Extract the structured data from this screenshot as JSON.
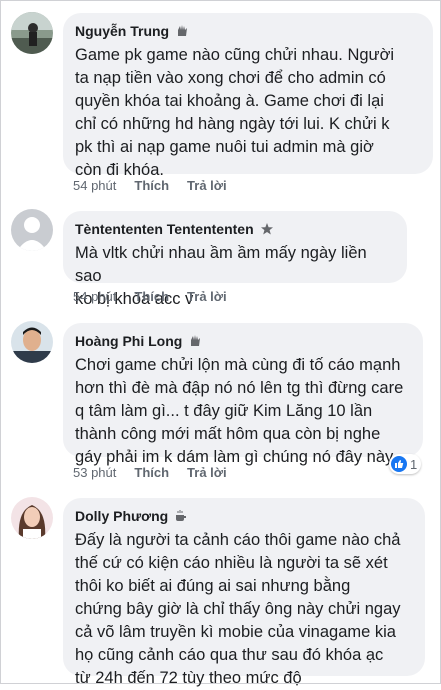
{
  "comments": [
    {
      "name": "Nguyễn Trung",
      "badge": "wave-icon",
      "text": "Game pk game nào cũng chửi nhau. Người\nta nạp tiền vào xong chơi để cho admin có\nquyền khóa tai khoảng à. Game chơi đi lại\nchỉ có những hd hàng ngày tới lui. K chửi k\npk thì ai nạp game nuôi tui admin mà giờ\ncòn đi khóa.",
      "time": "54 phút",
      "like": "Thích",
      "reply": "Trả lời"
    },
    {
      "name": "Tèntententen Tentententen",
      "badge": "rising-star-icon",
      "text": "Mà vltk chửi nhau ầm ầm mấy ngày liền sao\nko bị khóa acc v",
      "time": "54 phút",
      "like": "Thích",
      "reply": "Trả lời"
    },
    {
      "name": "Hoàng Phi Long",
      "badge": "wave-icon",
      "text": "Chơi game chửi lộn mà cùng đi tố cáo mạnh\nhơn thì đè mà đập nó nó lên tg thì đừng care\nq tâm làm gì... t đây giữ Kim Lăng 10 lần\nthành công mới mất hôm qua còn bị nghe\ngáy phải im k dám làm gì chúng nó đây này",
      "time": "53 phút",
      "like": "Thích",
      "reply": "Trả lời",
      "reaction_count": "1"
    },
    {
      "name": "Dolly Phương",
      "badge": "coffee-icon",
      "text": "Đấy là người ta cảnh cáo thôi game nào chả\nthế cứ có kiện cáo nhiều là người ta sẽ xét\nthôi ko biết ai đúng ai sai nhưng bằng\nchứng bây giờ là chỉ thấy ông này chửi ngay\ncả võ lâm truyền kì mobie của vinagame kia\nhọ cũng cảnh cáo qua thư sau đó khóa ạc\ntừ 24h đến 72 tùy theo mức độ"
    }
  ],
  "colors": {
    "bubble": "#f0f1f4",
    "like_blue": "#1877f2",
    "meta": "#606770"
  }
}
